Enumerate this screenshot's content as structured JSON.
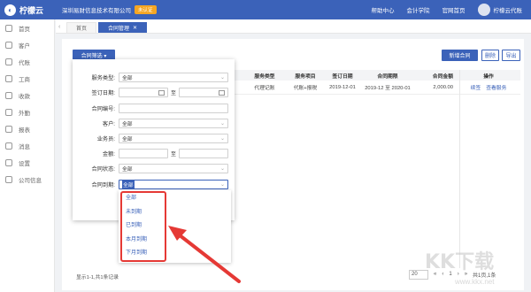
{
  "topbar": {
    "brand": "柠檬云",
    "company": "深圳易财信息技术有限公司",
    "badge": "未认证",
    "nav": [
      "帮助中心",
      "会计学院",
      "官网首页"
    ],
    "user": "柠檬云代账"
  },
  "sidebar": {
    "items": [
      {
        "label": "首页",
        "icon": "home-icon"
      },
      {
        "label": "客户",
        "icon": "client-icon"
      },
      {
        "label": "代账",
        "icon": "bookkeeping-icon"
      },
      {
        "label": "工商",
        "icon": "business-icon"
      },
      {
        "label": "收款",
        "icon": "payment-icon"
      },
      {
        "label": "外勤",
        "icon": "field-icon"
      },
      {
        "label": "报表",
        "icon": "report-icon"
      },
      {
        "label": "消息",
        "icon": "message-icon"
      },
      {
        "label": "设置",
        "icon": "settings-icon"
      },
      {
        "label": "公司信息",
        "icon": "company-icon"
      }
    ]
  },
  "tabs": {
    "home": "首页",
    "active": "合同管理",
    "close": "✕"
  },
  "toolbar": {
    "filter": "合同筛选 ▾",
    "add": "新增合同",
    "delete": "删除",
    "export": "导出"
  },
  "table": {
    "headers": [
      "服务类型",
      "服务项目",
      "签订日期",
      "合同期限",
      "合同金额",
      "操作"
    ],
    "row": {
      "type": "代理记账",
      "item": "代账+报税",
      "date": "2019-12-01",
      "period": "2019-12 至 2020-01",
      "amount": "2,000.00",
      "op1": "续签",
      "op2": "查看服务"
    }
  },
  "filter": {
    "service_type_label": "服务类型:",
    "service_type_value": "全部",
    "sign_date_label": "签订日期:",
    "to": "至",
    "contract_no_label": "合同编号:",
    "customer_label": "客户:",
    "customer_value": "全部",
    "salesman_label": "业务员:",
    "salesman_value": "全部",
    "amount_label": "金额:",
    "status_label": "合同状态:",
    "status_value": "全部",
    "expiry_label": "合同到期:",
    "expiry_value": "全部",
    "options": [
      "全部",
      "未到期",
      "已到期",
      "本月到期",
      "下月到期"
    ]
  },
  "footer": {
    "summary": "显示1-1,共1条记录",
    "page_size": "20",
    "pager": [
      "«",
      "‹",
      "1",
      "›",
      "»"
    ],
    "page_info": "共1页,1条"
  },
  "watermark": {
    "logo": "KK下载",
    "url": "www.kkx.net"
  },
  "colors": {
    "primary": "#3b62b9",
    "highlight": "#e53935",
    "badge": "#f5a623"
  }
}
